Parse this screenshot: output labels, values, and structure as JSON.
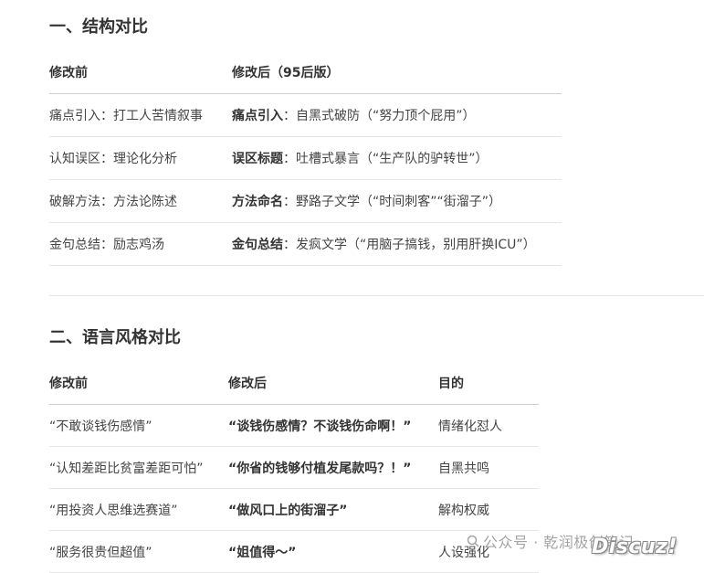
{
  "section1": {
    "title": "一、结构对比",
    "headers": [
      "修改前",
      "修改后（95后版）"
    ],
    "rows": [
      {
        "before": "痛点引入：打工人苦情叙事",
        "after_key": "痛点引入",
        "after_rest": "：自黑式破防（“努力顶个屁用”）"
      },
      {
        "before": "认知误区：理论化分析",
        "after_key": "误区标题",
        "after_rest": "：吐槽式暴言（“生产队的驴转世”）"
      },
      {
        "before": "破解方法：方法论陈述",
        "after_key": "方法命名",
        "after_rest": "：野路子文学（“时间刺客”“街溜子”）"
      },
      {
        "before": "金句总结：励志鸡汤",
        "after_key": "金句总结",
        "after_rest": "：发疯文学（“用脑子搞钱，别用肝换ICU”）"
      }
    ]
  },
  "section2": {
    "title": "二、语言风格对比",
    "headers": [
      "修改前",
      "修改后",
      "目的"
    ],
    "rows": [
      {
        "before": "“不敢谈钱伤感情”",
        "after": "“谈钱伤感情？不谈钱伤命啊！”",
        "purpose": "情绪化怼人"
      },
      {
        "before": "“认知差距比贫富差距可怕”",
        "after": "“你省的钱够付植发尾款吗？！”",
        "purpose": "自黑共鸣"
      },
      {
        "before": "“用投资人思维选赛道”",
        "after": "“做风口上的街溜子”",
        "purpose": "解构权威"
      },
      {
        "before": "“服务很贵但超值”",
        "after": "“姐值得～”",
        "purpose": "人设强化"
      }
    ]
  },
  "watermark": {
    "text": "公众号 · 乾润极创笔记",
    "logo": "Discuz!",
    "icon": "wechat-search-icon"
  }
}
